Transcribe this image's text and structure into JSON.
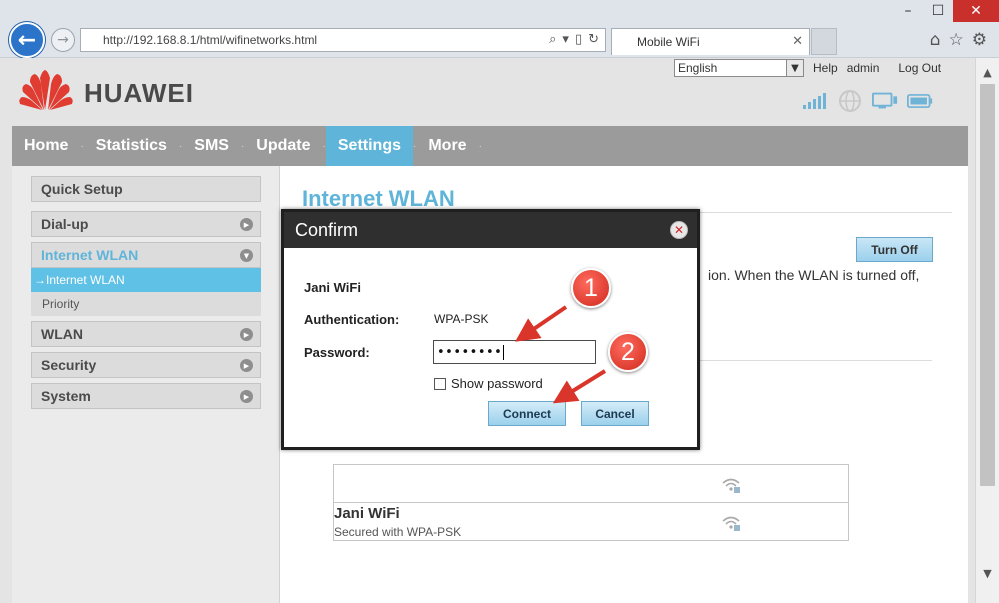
{
  "browser": {
    "address": "http://192.168.8.1/html/wifinetworks.html",
    "tab_title": "Mobile WiFi",
    "window_controls": [
      "minimize-icon",
      "maximize-icon",
      "close-icon"
    ],
    "toolbar_icons": [
      "home-icon",
      "star-icon",
      "gear-icon"
    ]
  },
  "header": {
    "brand": "HUAWEI",
    "language": "English",
    "links": {
      "help": "Help",
      "user": "admin",
      "logout": "Log Out"
    },
    "status_icons": [
      "signal-icon",
      "globe-icon",
      "pc-connection-icon",
      "battery-icon"
    ]
  },
  "mainnav": {
    "items": [
      "Home",
      "Statistics",
      "SMS",
      "Update",
      "Settings",
      "More"
    ],
    "active": "Settings"
  },
  "sidebar": {
    "quick_setup": "Quick Setup",
    "dialup": "Dial-up",
    "internet_wlan": "Internet WLAN",
    "sub_active": "→Internet WLAN",
    "sub_priority": "Priority",
    "wlan": "WLAN",
    "security": "Security",
    "system": "System"
  },
  "main": {
    "title": "Internet WLAN",
    "turn_off": "Turn Off",
    "description_fragment": "ion. When the WLAN is turned off,",
    "networks": [
      {
        "name": "",
        "security": ""
      },
      {
        "name": "Jani WiFi",
        "security": "Secured with WPA-PSK"
      }
    ]
  },
  "modal": {
    "title": "Confirm",
    "network": "Jani WiFi",
    "auth_label": "Authentication:",
    "auth_value": "WPA-PSK",
    "password_label": "Password:",
    "password_mask": "••••••••",
    "show_password": "Show password",
    "connect": "Connect",
    "cancel": "Cancel"
  },
  "annotations": {
    "callout_1": "1",
    "callout_2": "2",
    "color": "#d9352a"
  },
  "colors": {
    "accent": "#5fb4d9",
    "nav_bg": "#9b9b9b",
    "brand_red": "#e03c31"
  }
}
